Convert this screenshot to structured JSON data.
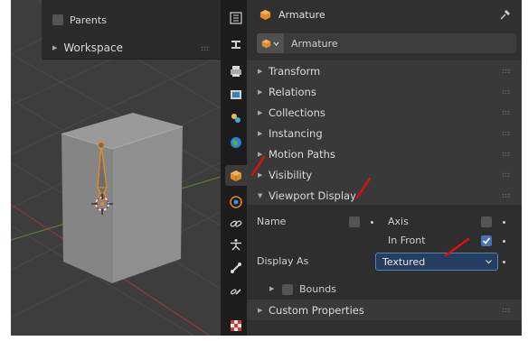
{
  "viewport": {
    "popover": {
      "parents_label": "Parents",
      "workspace_label": "Workspace"
    }
  },
  "tabs": [
    {
      "name": "tool",
      "active": false
    },
    {
      "name": "render",
      "active": false
    },
    {
      "name": "output",
      "active": false
    },
    {
      "name": "view-layer",
      "active": false
    },
    {
      "name": "scene",
      "active": false
    },
    {
      "name": "world",
      "active": false
    },
    {
      "name": "object",
      "active": true
    },
    {
      "name": "modifiers",
      "active": false
    },
    {
      "name": "constraints",
      "active": false
    },
    {
      "name": "physics",
      "active": false
    },
    {
      "name": "bone",
      "active": false
    },
    {
      "name": "bone-constraints",
      "active": false
    },
    {
      "name": "texture",
      "active": false
    }
  ],
  "properties": {
    "title": "Armature",
    "datablock_name": "Armature",
    "sections": {
      "transform": "Transform",
      "relations": "Relations",
      "collections": "Collections",
      "instancing": "Instancing",
      "motion_paths": "Motion Paths",
      "visibility": "Visibility",
      "viewport_display": "Viewport Display",
      "custom_properties": "Custom Properties"
    },
    "viewport_display": {
      "name_label": "Name",
      "name_checked": false,
      "axis_label": "Axis",
      "axis_checked": false,
      "in_front_label": "In Front",
      "in_front_checked": true,
      "display_as_label": "Display As",
      "display_as_value": "Textured",
      "bounds_label": "Bounds",
      "bounds_checked": false
    }
  },
  "colors": {
    "accent_blue": "#4772b3",
    "annotation_red": "#e01010",
    "object_orange": "#e08a2a"
  }
}
